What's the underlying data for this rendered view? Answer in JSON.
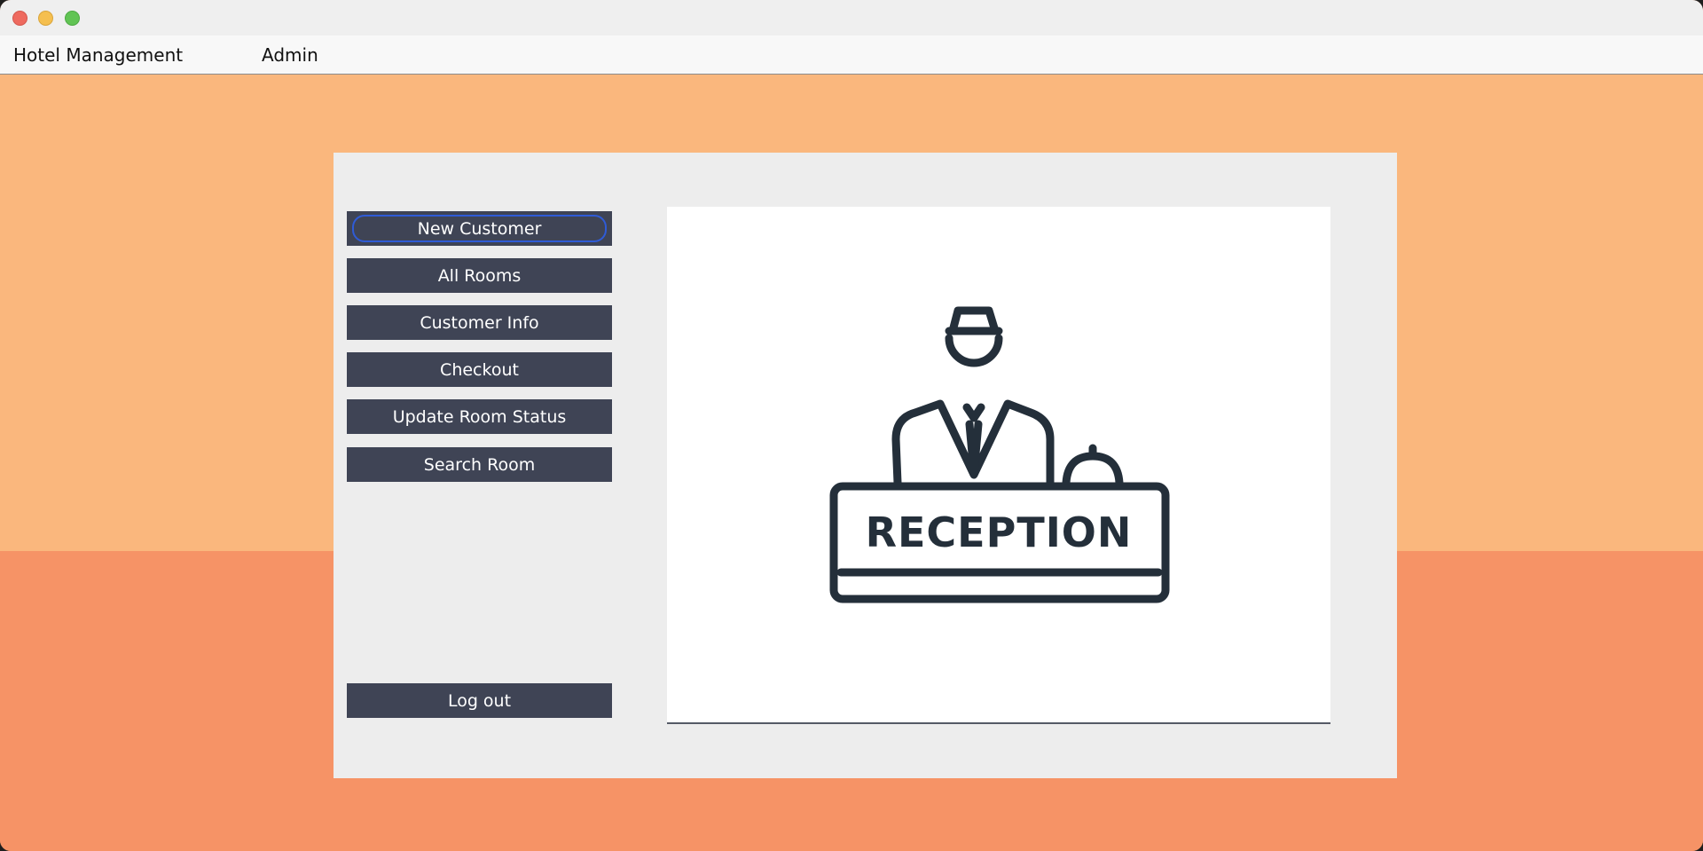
{
  "window": {
    "controls": [
      "close-icon",
      "minimize-icon",
      "maximize-icon"
    ]
  },
  "menubar": {
    "items": [
      {
        "label": "Hotel Management"
      },
      {
        "label": "Admin"
      }
    ]
  },
  "sidebar": {
    "buttons": [
      {
        "label": "New Customer",
        "focused": true
      },
      {
        "label": "All Rooms"
      },
      {
        "label": "Customer Info"
      },
      {
        "label": "Checkout"
      },
      {
        "label": "Update Room Status"
      },
      {
        "label": "Search Room"
      }
    ],
    "logout": {
      "label": "Log out"
    }
  },
  "main": {
    "image": {
      "icon": "reception-desk-icon",
      "sign_text": "RECEPTION"
    }
  },
  "colors": {
    "background_top": "#fab77d",
    "background_bottom": "#f69366",
    "panel": "#ededed",
    "button": "#3f4455",
    "button_text": "#ffffff",
    "focus_ring": "#2f5bd6",
    "icon_stroke": "#242f3a"
  }
}
